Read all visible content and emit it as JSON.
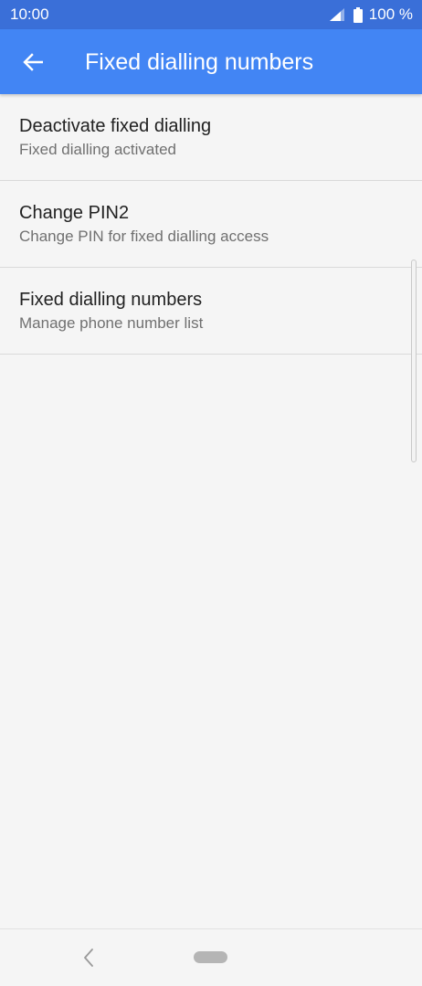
{
  "status_bar": {
    "time": "10:00",
    "battery_text": "100 %",
    "icons": [
      "signal-icon",
      "battery-icon"
    ]
  },
  "app_bar": {
    "title": "Fixed dialling numbers",
    "back_icon": "arrow-back-icon"
  },
  "list": {
    "items": [
      {
        "title": "Deactivate fixed dialling",
        "subtitle": "Fixed dialling activated"
      },
      {
        "title": "Change PIN2",
        "subtitle": "Change PIN for fixed dialling access"
      },
      {
        "title": "Fixed dialling numbers",
        "subtitle": "Manage phone number list"
      }
    ]
  },
  "nav_bar": {
    "icons": [
      "chevron-left-icon",
      "home-pill-icon"
    ]
  },
  "colors": {
    "status_bar": "#3a6fd8",
    "app_bar": "#4285f4",
    "background": "#f5f5f5",
    "title_text": "#212121",
    "subtitle_text": "#707070"
  }
}
